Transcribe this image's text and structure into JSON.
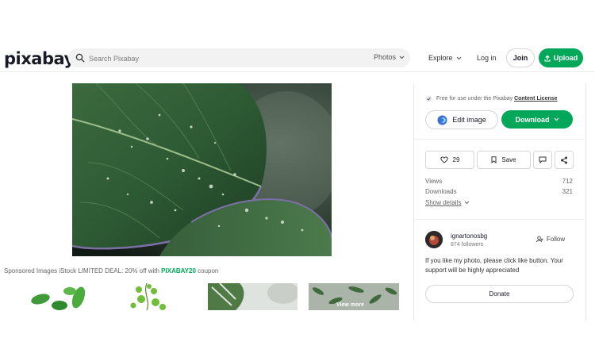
{
  "header": {
    "logo": "pixabay",
    "search_placeholder": "Search Pixabay",
    "search_type": "Photos",
    "explore": "Explore",
    "login": "Log in",
    "join": "Join",
    "upload": "Upload"
  },
  "main": {
    "sponsored_prefix": "Sponsored Images iStock LIMITED DEAL: 20% off with ",
    "sponsored_code": "PIXABAY20",
    "sponsored_suffix": " coupon",
    "view_more": "View more"
  },
  "panel": {
    "license_text": "Free for use under the Pixabay",
    "license_link": "Content License",
    "edit_image": "Edit image",
    "download": "Download",
    "likes": "29",
    "save": "Save",
    "views_label": "Views",
    "views_value": "712",
    "downloads_label": "Downloads",
    "downloads_value": "321",
    "show_details": "Show details",
    "username": "ignartonosbg",
    "followers": "874 followers",
    "follow": "Follow",
    "message": "If you like my photo, please click like button. Your support will be highly appreciated",
    "donate": "Donate"
  },
  "colors": {
    "accent": "#02a75a"
  },
  "icons": [
    "search-icon",
    "chevron-down-icon",
    "upload-icon",
    "check-badge-icon",
    "edit-image-icon",
    "heart-icon",
    "bookmark-icon",
    "comment-icon",
    "share-icon",
    "follow-icon"
  ]
}
